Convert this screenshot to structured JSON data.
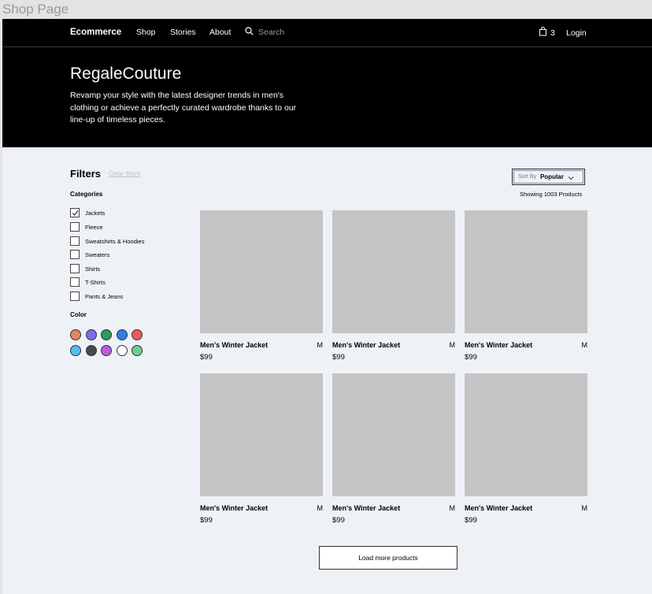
{
  "window": {
    "title": "Shop Page"
  },
  "nav": {
    "brand": "Ecommerce",
    "links": [
      "Shop",
      "Stories",
      "About"
    ],
    "search_placeholder": "Search",
    "cart_count": "3",
    "login": "Login"
  },
  "hero": {
    "title": "RegaleCouture",
    "description": "Revamp your style with the latest designer trends in men's clothing or achieve a perfectly curated wardrobe thanks to our line-up of timeless pieces."
  },
  "filters": {
    "title": "Filters",
    "clear": "Clear filters",
    "categories_title": "Categories",
    "categories": [
      {
        "label": "Jackets",
        "checked": true
      },
      {
        "label": "Fleece",
        "checked": false
      },
      {
        "label": "Sweatshirts & Hoodies",
        "checked": false
      },
      {
        "label": "Sweaters",
        "checked": false
      },
      {
        "label": "Shirts",
        "checked": false
      },
      {
        "label": "T-Shirts",
        "checked": false
      },
      {
        "label": "Pants & Jeans",
        "checked": false
      }
    ],
    "color_title": "Color",
    "colors": [
      "#e0875e",
      "#7c6cf0",
      "#2e9b5a",
      "#2f7ee8",
      "#ec5a5a",
      "#4fbff0",
      "#4a4a4a",
      "#b85ee0",
      "#ffffff",
      "#6cce94"
    ]
  },
  "sort": {
    "label": "Sort By",
    "value": "Popular"
  },
  "results": {
    "showing": "Showing 1003 Products"
  },
  "products": [
    {
      "name": "Men's Winter Jacket",
      "size": "M",
      "price": "$99"
    },
    {
      "name": "Men's Winter Jacket",
      "size": "M",
      "price": "$99"
    },
    {
      "name": "Men's Winter Jacket",
      "size": "M",
      "price": "$99"
    },
    {
      "name": "Men's Winter Jacket",
      "size": "M",
      "price": "$99"
    },
    {
      "name": "Men's Winter Jacket",
      "size": "M",
      "price": "$99"
    },
    {
      "name": "Men's Winter Jacket",
      "size": "M",
      "price": "$99"
    }
  ],
  "load_more": "Load more products"
}
